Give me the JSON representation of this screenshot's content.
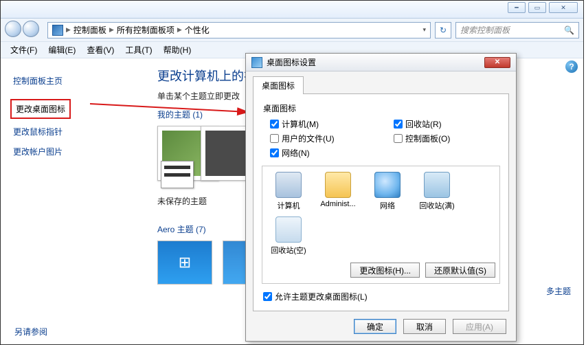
{
  "window_controls": {
    "minimize": "━",
    "maximize": "▭",
    "close": "✕"
  },
  "breadcrumb": {
    "items": [
      "控制面板",
      "所有控制面板项",
      "个性化"
    ],
    "search_placeholder": "搜索控制面板"
  },
  "menubar": {
    "file": "文件(F)",
    "edit": "编辑(E)",
    "view": "查看(V)",
    "tools": "工具(T)",
    "help": "帮助(H)"
  },
  "sidebar": {
    "home": "控制面板主页",
    "change_desktop_icons": "更改桌面图标",
    "change_mouse_pointers": "更改鼠标指针",
    "change_account_picture": "更改帐户图片",
    "see_also": "另请参阅"
  },
  "content": {
    "title": "更改计算机上的视",
    "subtitle": "单击某个主题立即更改",
    "my_themes": "我的主题 (1)",
    "unsaved_theme": "未保存的主题",
    "aero_themes": "Aero 主题 (7)",
    "more_themes": "多主题"
  },
  "dialog": {
    "title": "桌面图标设置",
    "tab": "桌面图标",
    "group_label": "桌面图标",
    "checkboxes": {
      "computer": "计算机(M)",
      "recycle_bin": "回收站(R)",
      "user_files": "用户的文件(U)",
      "control_panel": "控制面板(O)",
      "network": "网络(N)"
    },
    "icons": {
      "computer": "计算机",
      "admin": "Administ...",
      "network": "网络",
      "recycle_full": "回收站(满)",
      "recycle_empty": "回收站(空)"
    },
    "buttons": {
      "change_icon": "更改图标(H)...",
      "restore_default": "还原默认值(S)"
    },
    "allow_themes": "允许主题更改桌面图标(L)",
    "footer": {
      "ok": "确定",
      "cancel": "取消",
      "apply": "应用(A)"
    }
  }
}
